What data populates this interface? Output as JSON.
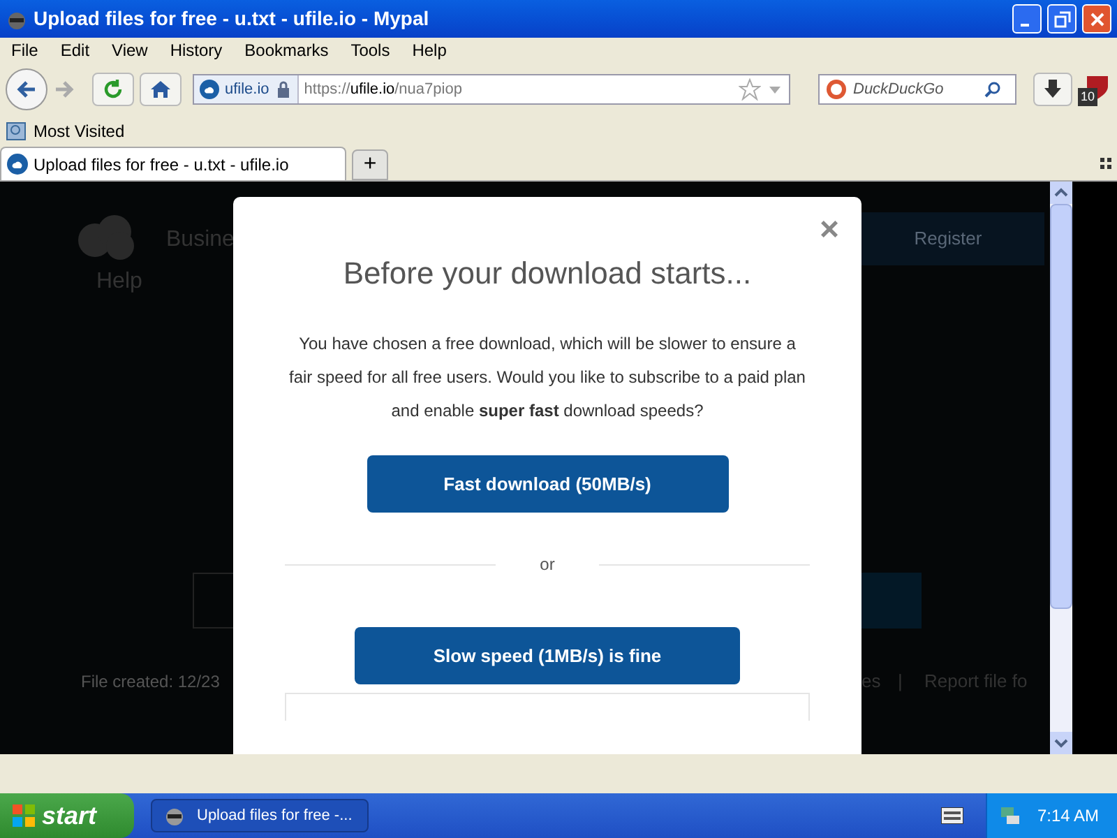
{
  "window": {
    "title": "Upload files for free - u.txt - ufile.io - Mypal"
  },
  "menu": [
    "File",
    "Edit",
    "View",
    "History",
    "Bookmarks",
    "Tools",
    "Help"
  ],
  "address_bar": {
    "site": "ufile.io",
    "url_prefix": "https://",
    "url_host": "ufile.io",
    "url_path": "/nua7piop"
  },
  "search": {
    "placeholder": "DuckDuckGo"
  },
  "addon_badge": "10",
  "bookmarks": [
    "Most Visited"
  ],
  "tabs": [
    {
      "label": "Upload files for free - u.txt - ufile.io",
      "selected": true
    }
  ],
  "new_tab": "+",
  "background_page": {
    "nav": "Busine",
    "help": "Help",
    "register": "Register",
    "file_created": "File created: 12/23",
    "files_fragment": "es",
    "separator": "|",
    "report": "Report file fo"
  },
  "modal": {
    "close": "×",
    "title": "Before your download starts...",
    "body": "You have chosen a free download, which will be slower to ensure a fair speed for all free users. Would you like to subscribe to a paid plan and enable **super fast** download speeds?",
    "fast_button": "Fast download (50MB/s)",
    "or": "or",
    "slow_button": "Slow speed (1MB/s) is fine"
  },
  "taskbar": {
    "start": "start",
    "items": [
      {
        "label": "Upload files for free -...",
        "selected": true
      }
    ],
    "clock": "7:14 AM"
  }
}
